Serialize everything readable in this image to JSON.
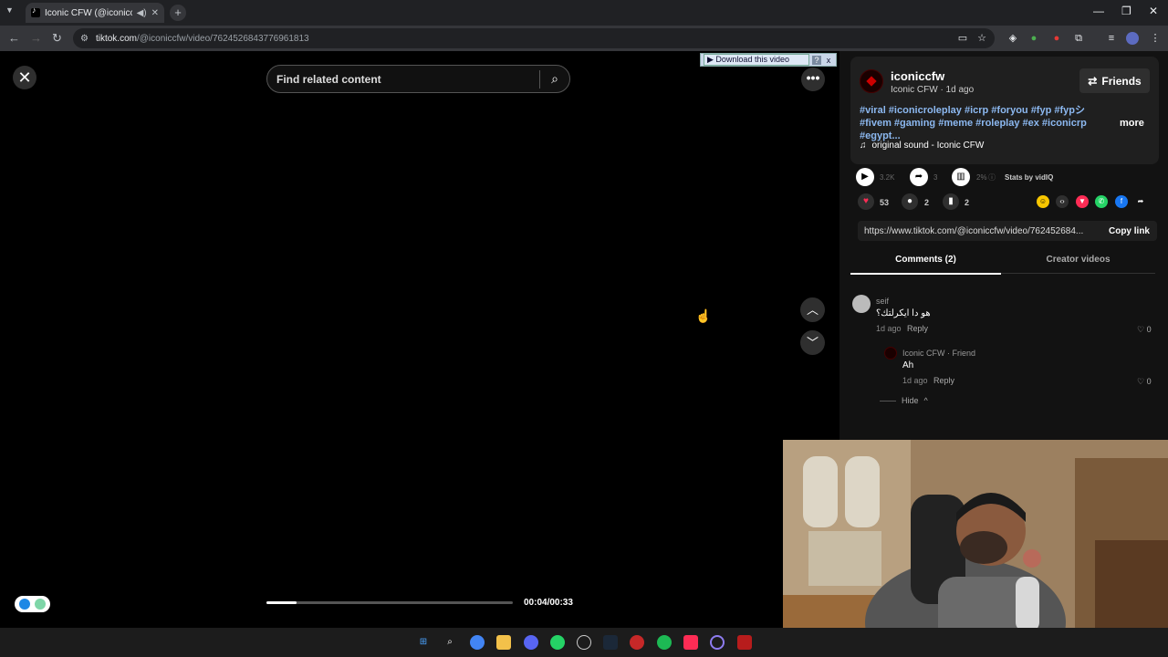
{
  "browser": {
    "tab_title": "Iconic CFW (@iconiccfw) | T",
    "tab_audio_icon": "speaker-icon",
    "url_domain": "tiktok.com",
    "url_path": "/@iconiccfw/video/7624526843776961813"
  },
  "player": {
    "search_placeholder": "Find related content",
    "download_label": "▶ Download this video",
    "download_help": "?",
    "download_close": "x",
    "time": "00:04/00:33",
    "progress_fraction": 0.1212
  },
  "creator": {
    "username": "iconiccfw",
    "subtitle": "Iconic CFW · 1d ago",
    "friends_label": "Friends",
    "hashtags": "#viral #iconicroleplay #icrp #foryou #fyp #fypシ #fivem #gaming #meme #roleplay #ex #iconicrp #egypt...",
    "more_label": "more",
    "music": "original sound - Iconic CFW"
  },
  "stats": {
    "plays": "3.2K",
    "shares": "3",
    "rate": "2%",
    "vidiq": "Stats by vidIQ",
    "likes": "53",
    "comments": "2",
    "saves": "2"
  },
  "link": {
    "url": "https://www.tiktok.com/@iconiccfw/video/762452684...",
    "copy_label": "Copy link"
  },
  "tabs": {
    "comments": "Comments (2)",
    "creator_videos": "Creator videos"
  },
  "comments": [
    {
      "name": "seif",
      "text": "هو دا ايكرلتك؟",
      "time": "1d ago",
      "reply": "Reply",
      "likes": "0"
    },
    {
      "name": "Iconic CFW · Friend",
      "text": "Ah",
      "time": "1d ago",
      "reply": "Reply",
      "likes": "0"
    }
  ],
  "hide_label": "Hide"
}
